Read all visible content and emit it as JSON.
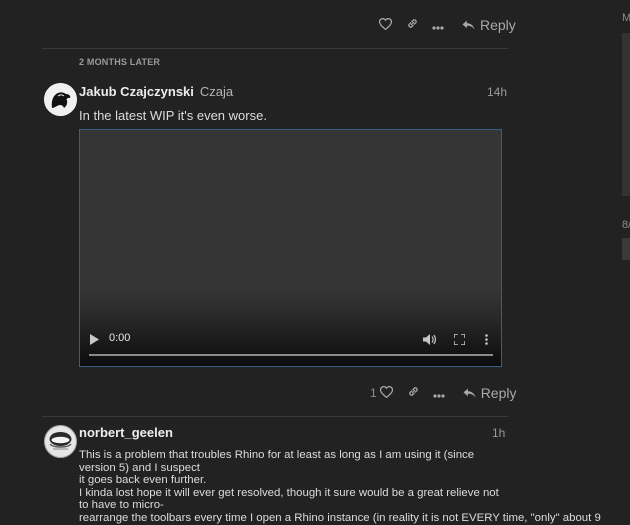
{
  "top_actions": {
    "reply_label": "Reply"
  },
  "time_gap": {
    "label": "2 MONTHS LATER"
  },
  "post1": {
    "username": "Jakub Czajczynski",
    "name": "Czaja",
    "time": "14h",
    "text": "In the latest WIP it's even worse.",
    "video": {
      "time": "0:00",
      "progress": 0
    },
    "like_count": "1",
    "reply_label": "Reply"
  },
  "post2": {
    "username": "norbert_geelen",
    "time": "1h",
    "lines": [
      "This is a problem that troubles Rhino for at least as long as I am using it (since version 5) and I suspect",
      "it goes back even further.",
      "I kinda lost hope it will ever get resolved, though it sure would be a great relieve not to have to micro-",
      "rearrange the toolbars every time I open a Rhino instance (in reality it is not EVERY time, \"only\" about 9"
    ]
  },
  "sidebar": {
    "top_label": "M",
    "mid_label": "8/"
  }
}
